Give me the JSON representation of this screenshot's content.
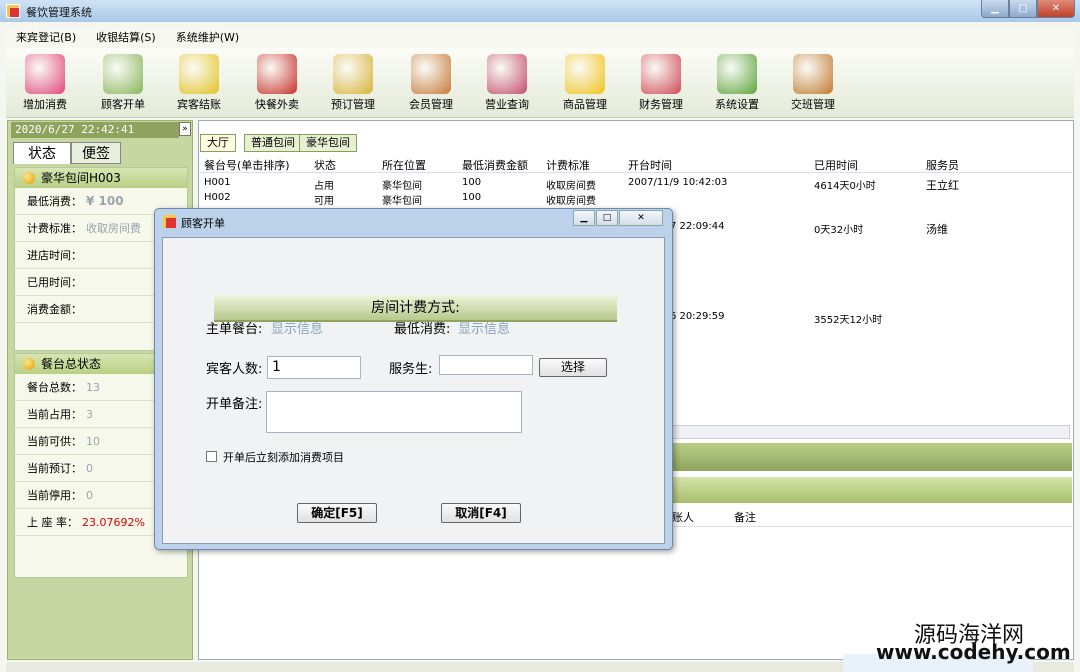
{
  "window": {
    "title": "餐饮管理系统"
  },
  "menu": [
    "来宾登记(B)",
    "收银结算(S)",
    "系统维护(W)"
  ],
  "toolbar": [
    {
      "label": "增加消费",
      "icon": "add-consumption-icon",
      "color": "#e2477a"
    },
    {
      "label": "顾客开单",
      "icon": "teacup-icon",
      "color": "#8ab55a"
    },
    {
      "label": "宾客结账",
      "icon": "checkout-arrow-icon",
      "color": "#e3c323"
    },
    {
      "label": "快餐外卖",
      "icon": "takeout-bowl-icon",
      "color": "#c8312a"
    },
    {
      "label": "预订管理",
      "icon": "clock-icon",
      "color": "#d9b33a"
    },
    {
      "label": "会员管理",
      "icon": "members-icon",
      "color": "#c77b3b"
    },
    {
      "label": "营业查询",
      "icon": "report-query-icon",
      "color": "#c44d6e"
    },
    {
      "label": "商品管理",
      "icon": "star-icon",
      "color": "#f2c21b"
    },
    {
      "label": "财务管理",
      "icon": "calculator-icon",
      "color": "#d24856"
    },
    {
      "label": "系统设置",
      "icon": "gear-icon",
      "color": "#5fa33b"
    },
    {
      "label": "交班管理",
      "icon": "exit-door-icon",
      "color": "#c27a2f"
    }
  ],
  "left": {
    "clock": "2020/6/27 22:42:41",
    "tabs": [
      "状态",
      "便签"
    ],
    "room": {
      "title": "豪华包间H003",
      "rows": [
        {
          "label": "最低消费：",
          "value": "¥ 100"
        },
        {
          "label": "计费标准：",
          "value": "收取房间费"
        },
        {
          "label": "进店时间：",
          "value": ""
        },
        {
          "label": "已用时间：",
          "value": ""
        },
        {
          "label": "消费金额：",
          "value": ""
        }
      ]
    },
    "summary": {
      "title": "餐台总状态",
      "rows": [
        {
          "label": "餐台总数：",
          "value": "13"
        },
        {
          "label": "当前占用：",
          "value": "3"
        },
        {
          "label": "当前可供：",
          "value": "10"
        },
        {
          "label": "当前预订：",
          "value": "0"
        },
        {
          "label": "当前停用：",
          "value": "0"
        },
        {
          "label": "上 座 率：",
          "value": "23.07692%"
        }
      ]
    }
  },
  "room_tabs": [
    "大厅",
    "普通包间",
    "豪华包间"
  ],
  "grid": {
    "headers": [
      "餐台号(单击排序)",
      "状态",
      "所在位置",
      "最低消费金额",
      "计费标准",
      "开台时间",
      "已用时间",
      "服务员"
    ],
    "rows": [
      [
        "H001",
        "占用",
        "豪华包间",
        "100",
        "收取房间费",
        "2007/11/9 10:42:03",
        "4614天0小时",
        "王立红"
      ],
      [
        "H002",
        "可用",
        "豪华包间",
        "100",
        "收取房间费",
        "",
        "",
        ""
      ],
      [
        "",
        "",
        "",
        "",
        "",
        "7 22:09:44",
        "0天32小时",
        "汤维"
      ],
      [
        "",
        "",
        "",
        "",
        "",
        "6 20:29:59",
        "3552天12小时",
        ""
      ]
    ]
  },
  "lower_grid": {
    "headers": [
      "账人",
      "备注"
    ]
  },
  "dialog": {
    "title": "顾客开单",
    "banner": "房间计费方式:",
    "main_table_label": "主单餐台:",
    "main_table_value": "显示信息",
    "min_spend_label": "最低消费:",
    "min_spend_value": "显示信息",
    "guests_label": "宾客人数:",
    "guests_value": "1",
    "waiter_label": "服务生:",
    "select_button": "选择",
    "remark_label": "开单备注:",
    "checkbox_label": "开单后立刻添加消费项目",
    "ok_button": "确定[F5]",
    "cancel_button": "取消[F4]"
  },
  "watermark": {
    "text": "源码海洋网",
    "url": "www.codehy.com"
  }
}
